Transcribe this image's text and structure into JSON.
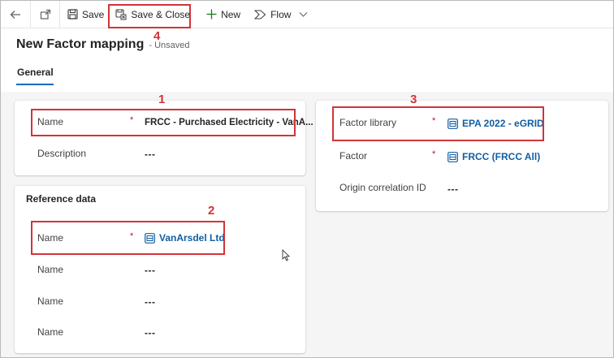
{
  "toolbar": {
    "back_icon": "back-arrow-icon",
    "popout_icon": "pop-out-icon",
    "save_label": "Save",
    "save_close_label": "Save & Close",
    "new_label": "New",
    "flow_label": "Flow"
  },
  "header": {
    "title": "New Factor mapping",
    "status": "- Unsaved"
  },
  "tabs": [
    {
      "label": "General",
      "selected": true
    }
  ],
  "main_card": {
    "fields": [
      {
        "label": "Name",
        "required": true,
        "value": "FRCC - Purchased Electricity - VanA..."
      },
      {
        "label": "Description",
        "required": false,
        "value": "---"
      }
    ]
  },
  "reference_card": {
    "title": "Reference data",
    "fields": [
      {
        "label": "Name",
        "required": true,
        "value": "VanArsdel Ltd",
        "lookup": true
      },
      {
        "label": "Name",
        "required": false,
        "value": "---"
      },
      {
        "label": "Name",
        "required": false,
        "value": "---"
      },
      {
        "label": "Name",
        "required": false,
        "value": "---"
      }
    ]
  },
  "factor_card": {
    "fields": [
      {
        "label": "Factor library",
        "required": true,
        "value": "EPA 2022 - eGRID",
        "lookup": true
      },
      {
        "label": "Factor",
        "required": true,
        "value": "FRCC (FRCC All)",
        "lookup": true
      },
      {
        "label": "Origin correlation ID",
        "required": false,
        "value": "---"
      }
    ]
  },
  "required_marker": "*",
  "annotations": [
    "1",
    "2",
    "3",
    "4"
  ],
  "colors": {
    "accent": "#0f6cbd",
    "lookup_link": "#115ea3",
    "required": "#c50f1f",
    "annotation": "#d13438",
    "background": "#f5f5f5"
  }
}
